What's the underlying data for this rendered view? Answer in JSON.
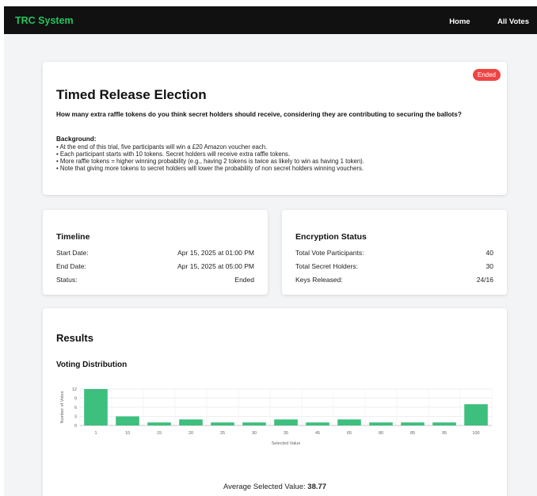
{
  "nav": {
    "brand": "TRC System",
    "links": [
      "Home",
      "All Votes"
    ]
  },
  "election": {
    "badge": "Ended",
    "title": "Timed Release Election",
    "question": "How many extra raffle tokens do you think secret holders should receive, considering they are contributing to securing the ballots?",
    "background_heading": "Background:",
    "background_items": [
      "• At the end of this trial, five participants will win a £20 Amazon voucher each.",
      "• Each participant starts with 10 tokens. Secret holders will receive extra raffle tokens.",
      "• More raffle tokens = higher winning probability (e.g., having 2 tokens is twice as likely to win as having 1 token).",
      "• Note that giving more tokens to secret holders will lower the probability of non secret holders winning vouchers."
    ]
  },
  "timeline": {
    "title": "Timeline",
    "rows": [
      {
        "label": "Start Date:",
        "value": "Apr 15, 2025 at 01:00 PM"
      },
      {
        "label": "End Date:",
        "value": "Apr 15, 2025 at 05:00 PM"
      },
      {
        "label": "Status:",
        "value": "Ended"
      }
    ]
  },
  "encryption": {
    "title": "Encryption Status",
    "rows": [
      {
        "label": "Total Vote Participants:",
        "value": "40"
      },
      {
        "label": "Total Secret Holders:",
        "value": "30"
      },
      {
        "label": "Keys Released:",
        "value": "24/16"
      }
    ]
  },
  "results": {
    "title": "Results",
    "distribution_title": "Voting Distribution",
    "avg_label": "Average Selected Value: ",
    "avg_value": "38.77"
  },
  "chart_data": {
    "type": "bar",
    "categories": [
      "1",
      "10",
      "15",
      "20",
      "25",
      "30",
      "35",
      "45",
      "65",
      "80",
      "85",
      "95",
      "100"
    ],
    "values": [
      12,
      3,
      1,
      2,
      1,
      1,
      2,
      1,
      2,
      1,
      1,
      1,
      7
    ],
    "xlabel": "Selected Value",
    "ylabel": "Number of Votes",
    "ylim": [
      0,
      12
    ],
    "yticks": [
      0,
      3,
      6,
      9,
      12
    ],
    "grid": true,
    "bar_color": "#3dbf7e"
  },
  "colors": {
    "brand": "#22c55e",
    "badge": "#ef4444",
    "bar": "#3dbf7e",
    "topbar": "#111111"
  }
}
